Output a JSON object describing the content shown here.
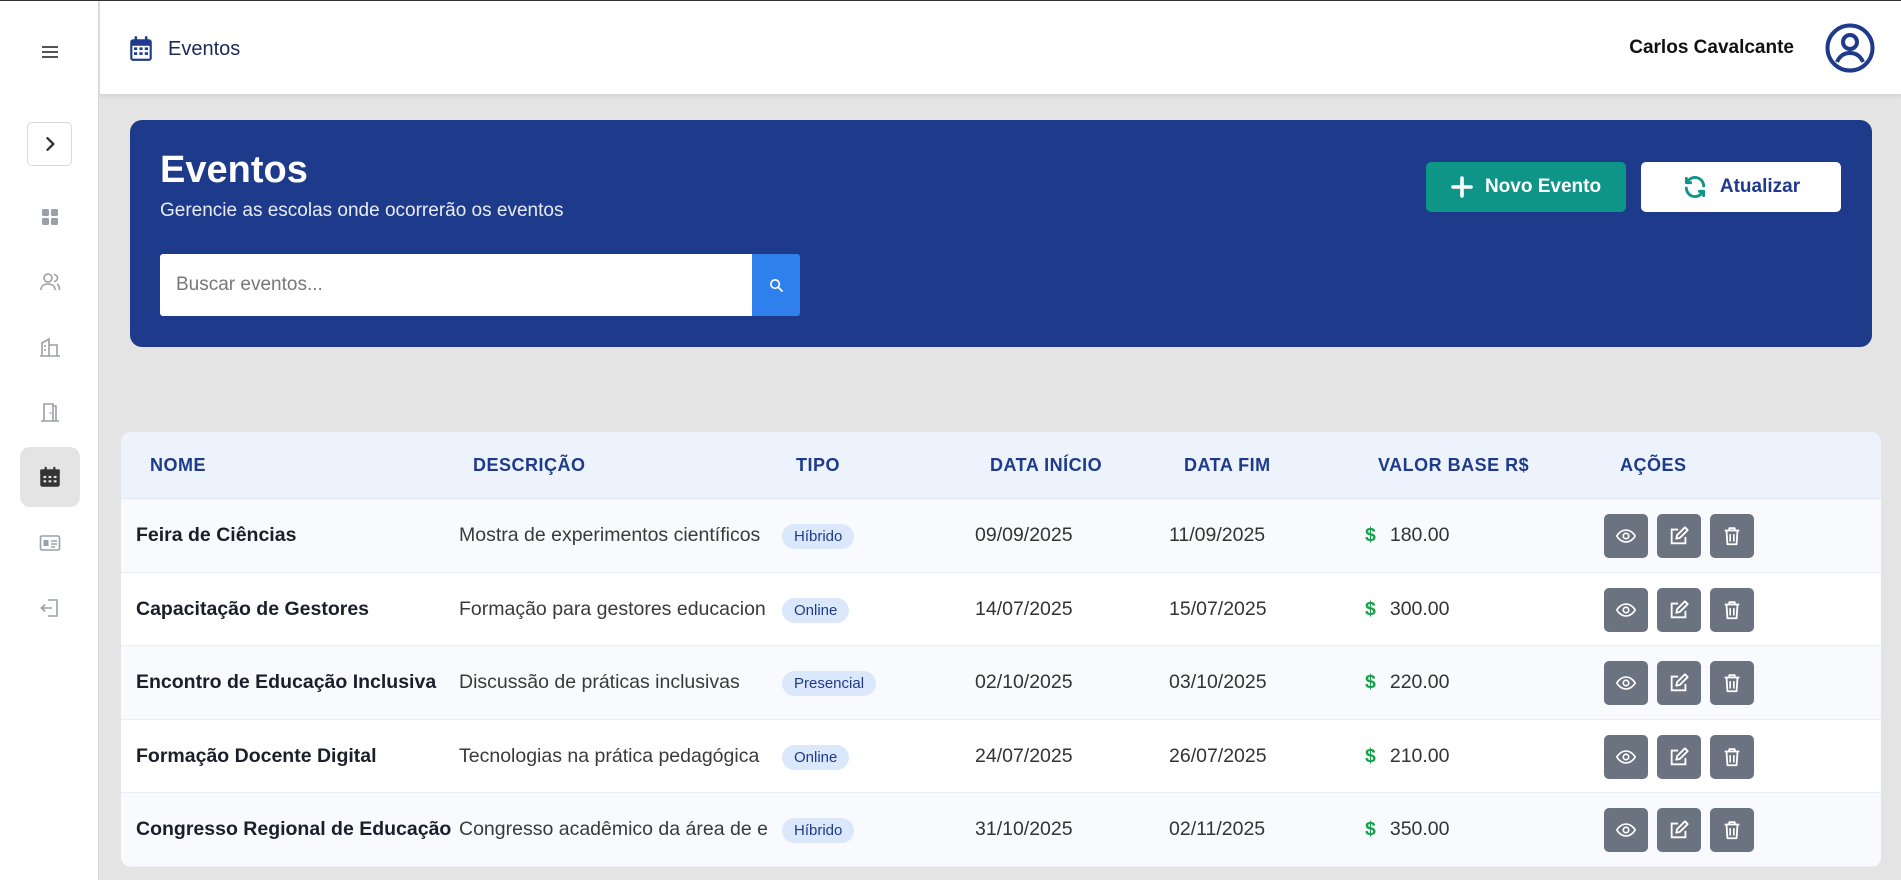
{
  "topbar": {
    "section_label": "Eventos",
    "user_name": "Carlos Cavalcante"
  },
  "hero": {
    "title": "Eventos",
    "subtitle": "Gerencie as escolas onde ocorrerão os eventos",
    "new_button_label": "Novo Evento",
    "refresh_button_label": "Atualizar",
    "search_placeholder": "Buscar eventos..."
  },
  "sidebar": {
    "items": [
      "menu-icon",
      "expand-icon",
      "dashboard-icon",
      "users-icon",
      "building-icon",
      "door-icon",
      "calendar-icon",
      "id-card-icon",
      "logout-icon"
    ],
    "active": "calendar-icon"
  },
  "table": {
    "headers": [
      "NOME",
      "DESCRIÇÃO",
      "TIPO",
      "DATA INÍCIO",
      "DATA FIM",
      "VALOR BASE R$",
      "AÇÕES"
    ],
    "rows": [
      {
        "nome": "Feira de Ciências",
        "descricao": "Mostra de experimentos científicos",
        "tipo": "Híbrido",
        "inicio": "09/09/2025",
        "fim": "11/09/2025",
        "valor": "180.00"
      },
      {
        "nome": "Capacitação de Gestores",
        "descricao": "Formação para gestores educacion",
        "tipo": "Online",
        "inicio": "14/07/2025",
        "fim": "15/07/2025",
        "valor": "300.00"
      },
      {
        "nome": "Encontro de Educação Inclusiva",
        "descricao": "Discussão de práticas inclusivas",
        "tipo": "Presencial",
        "inicio": "02/10/2025",
        "fim": "03/10/2025",
        "valor": "220.00"
      },
      {
        "nome": "Formação Docente Digital",
        "descricao": "Tecnologias na prática pedagógica",
        "tipo": "Online",
        "inicio": "24/07/2025",
        "fim": "26/07/2025",
        "valor": "210.00"
      },
      {
        "nome": "Congresso Regional de Educação",
        "descricao": "Congresso acadêmico da área de e",
        "tipo": "Híbrido",
        "inicio": "31/10/2025",
        "fim": "02/11/2025",
        "valor": "350.00"
      }
    ],
    "currency_symbol": "$"
  },
  "colors": {
    "primary": "#1e3a8a",
    "accent_green": "#0f9488",
    "search_blue": "#2f80ed",
    "money_green": "#16a34a",
    "action_gray": "#6b7280"
  }
}
